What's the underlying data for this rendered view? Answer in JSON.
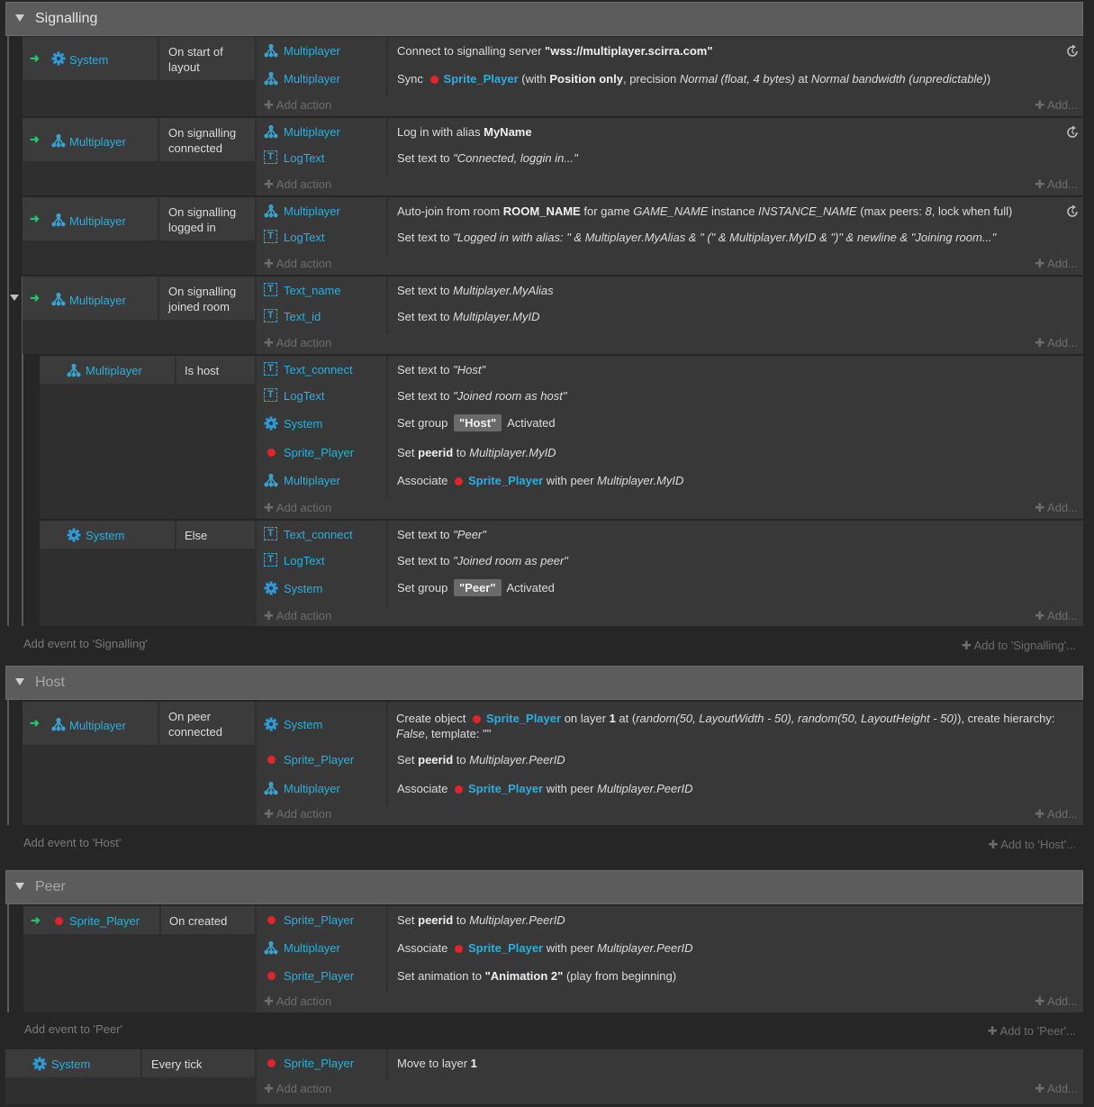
{
  "groups": {
    "signalling": "Signalling",
    "host": "Host",
    "peer": "Peer"
  },
  "common": {
    "add_action": "Add action",
    "add": "Add..."
  },
  "add_event": {
    "signalling": "Add event to 'Signalling'",
    "signalling_right": "Add to 'Signalling'...",
    "host": "Add event to 'Host'",
    "host_right": "Add to 'Host'...",
    "peer": "Add event to 'Peer'",
    "peer_right": "Add to 'Peer'..."
  },
  "objects": {
    "system": "System",
    "multiplayer": "Multiplayer",
    "logtext": "LogText",
    "text_name": "Text_name",
    "text_id": "Text_id",
    "text_connect": "Text_connect",
    "sprite_player": "Sprite_Player"
  },
  "conditions": {
    "start": "On start of layout",
    "connected": "On signalling connected",
    "logged": "On signalling logged in",
    "joined": "On signalling joined room",
    "ishost": "Is host",
    "else": "Else",
    "peerconnected": "On peer connected",
    "oncreated": "On created",
    "everytick": "Every tick"
  },
  "icons": {
    "system": "gear-icon",
    "multiplayer": "multiplayer-icon",
    "text": "text-icon",
    "sprite": "sprite-dot-icon",
    "trigger": "trigger-arrow-icon",
    "async": "async-reload-icon"
  },
  "colors": {
    "object": "#2ab0e0",
    "trigger": "#27c46b",
    "sprite": "#e2242c",
    "group": "#5c5c5c"
  },
  "actions": {
    "e1a1": "Connect to signalling server",
    "e1a1v": "\"wss://multiplayer.scirra.com\"",
    "e1a2p": "Sync",
    "e1a2s": "Sprite_Player",
    "e1a2r1": "(with",
    "e1a2b": "Position only",
    "e1a2r2": ", precision",
    "e1a2i1": "Normal (float, 4 bytes)",
    "e1a2r3": "at",
    "e1a2i2": "Normal bandwidth (unpredictable)",
    "e1a2r4": ")",
    "e2a1": "Log in with alias",
    "e2a1b": "MyName",
    "e2a2": "Set text to",
    "e2a2i": "\"Connected, loggin in...\"",
    "e3a1p": "Auto-join from room",
    "e3a1b": "ROOM_NAME",
    "e3a1r1": "for game",
    "e3a1i1": "GAME_NAME",
    "e3a1r2": "instance",
    "e3a1i2": "INSTANCE_NAME",
    "e3a1r3": "(max peers:",
    "e3a1i3": "8",
    "e3a1r4": ", lock when full)",
    "e3a2": "Set text to",
    "e3a2i": "\"Logged in with alias: \" & Multiplayer.MyAlias & \" (\" & Multiplayer.MyID & \")\" & newline & \"Joining room...\"",
    "e4a1": "Set text to",
    "e4a1i": "Multiplayer.MyAlias",
    "e4a2": "Set text to",
    "e4a2i": "Multiplayer.MyID",
    "e5a1": "Set text to",
    "e5a1i": "\"Host\"",
    "e5a2": "Set text to",
    "e5a2i": "\"Joined room as host\"",
    "e5a3p": "Set group",
    "e5a3t": "\"Host\"",
    "e5a3s": "Activated",
    "e5a4p": "Set",
    "e5a4b": "peerid",
    "e5a4r": "to",
    "e5a4i": "Multiplayer.MyID",
    "e5a5p": "Associate",
    "e5a5s": "Sprite_Player",
    "e5a5r": "with peer",
    "e5a5i": "Multiplayer.MyID",
    "e6a1": "Set text to",
    "e6a1i": "\"Peer\"",
    "e6a2": "Set text to",
    "e6a2i": "\"Joined room as peer\"",
    "e6a3p": "Set group",
    "e6a3t": "\"Peer\"",
    "e6a3s": "Activated",
    "e7a1p": "Create object",
    "e7a1s": "Sprite_Player",
    "e7a1r1": "on layer",
    "e7a1b": "1",
    "e7a1r2": "at (",
    "e7a1i1": "random(50, LayoutWidth - 50), random(50, LayoutHeight - 50)",
    "e7a1r3": "), create hierarchy:",
    "e7a1i2": "False",
    "e7a1r4": ", template: \"\"",
    "e7a2p": "Set",
    "e7a2b": "peerid",
    "e7a2r": "to",
    "e7a2i": "Multiplayer.PeerID",
    "e7a3p": "Associate",
    "e7a3s": "Sprite_Player",
    "e7a3r": "with peer",
    "e7a3i": "Multiplayer.PeerID",
    "e8a1p": "Set",
    "e8a1b": "peerid",
    "e8a1r": "to",
    "e8a1i": "Multiplayer.PeerID",
    "e8a2p": "Associate",
    "e8a2s": "Sprite_Player",
    "e8a2r": "with peer",
    "e8a2i": "Multiplayer.PeerID",
    "e8a3p": "Set animation to",
    "e8a3b": "\"Animation 2\"",
    "e8a3r": "(play from beginning)",
    "e9a1p": "Move to layer",
    "e9a1b": "1"
  }
}
